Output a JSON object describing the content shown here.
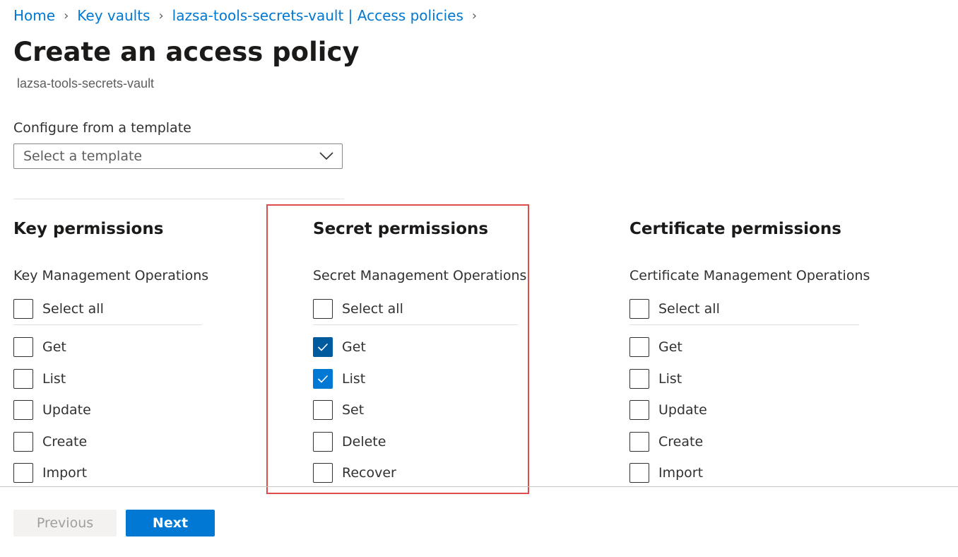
{
  "breadcrumb": {
    "items": [
      "Home",
      "Key vaults",
      "lazsa-tools-secrets-vault | Access policies"
    ]
  },
  "page": {
    "title": "Create an access policy",
    "more_label": "···",
    "subtitle": "lazsa-tools-secrets-vault"
  },
  "template": {
    "label": "Configure from a template",
    "placeholder": "Select a template"
  },
  "key": {
    "title": "Key permissions",
    "subtitle": "Key Management Operations",
    "select_all": "Select all",
    "items": [
      {
        "label": "Get",
        "checked": false
      },
      {
        "label": "List",
        "checked": false
      },
      {
        "label": "Update",
        "checked": false
      },
      {
        "label": "Create",
        "checked": false
      },
      {
        "label": "Import",
        "checked": false
      }
    ]
  },
  "secret": {
    "title": "Secret permissions",
    "subtitle": "Secret Management Operations",
    "select_all": "Select all",
    "items": [
      {
        "label": "Get",
        "checked": true
      },
      {
        "label": "List",
        "checked": true
      },
      {
        "label": "Set",
        "checked": false
      },
      {
        "label": "Delete",
        "checked": false
      },
      {
        "label": "Recover",
        "checked": false
      }
    ]
  },
  "certificate": {
    "title": "Certificate permissions",
    "subtitle": "Certificate Management Operations",
    "select_all": "Select all",
    "items": [
      {
        "label": "Get",
        "checked": false
      },
      {
        "label": "List",
        "checked": false
      },
      {
        "label": "Update",
        "checked": false
      },
      {
        "label": "Create",
        "checked": false
      },
      {
        "label": "Import",
        "checked": false
      }
    ]
  },
  "footer": {
    "previous_label": "Previous",
    "next_label": "Next"
  },
  "colors": {
    "accent": "#0078d4",
    "highlight_border": "#e04b4b"
  }
}
